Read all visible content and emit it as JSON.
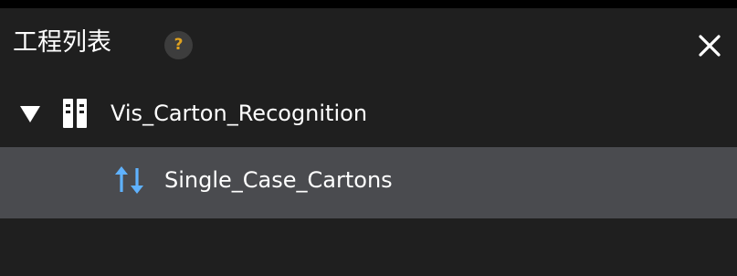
{
  "panel": {
    "title": "工程列表",
    "help_icon_glyph": "?",
    "help_icon": "help-icon",
    "close_icon": "close-icon"
  },
  "tree": {
    "project": {
      "label": "Vis_Carton_Recognition",
      "expanded": true,
      "icon": "project-icon"
    },
    "children": [
      {
        "label": "Single_Case_Cartons",
        "icon": "sort-arrows-icon",
        "selected": true
      }
    ]
  },
  "colors": {
    "panel_background": "#1f1f1f",
    "selected_row_background": "#4a4b4f",
    "help_icon_accent": "#e0a21f",
    "step_icon_accent": "#5fb2ff",
    "text": "#ffffff"
  }
}
